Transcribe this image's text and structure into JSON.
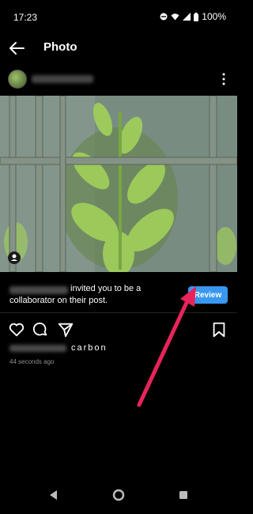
{
  "status": {
    "time": "17:23",
    "battery": "100%"
  },
  "app_bar": {
    "title": "Photo"
  },
  "collab_banner": {
    "message_line1": "invited you to be a",
    "message_line2": "collaborator on their post.",
    "review_label": "Review"
  },
  "caption": {
    "text": "carbon"
  },
  "timestamp": "44 seconds ago",
  "colors": {
    "accent": "#3897f0",
    "annotation_arrow": "#e8245a"
  }
}
